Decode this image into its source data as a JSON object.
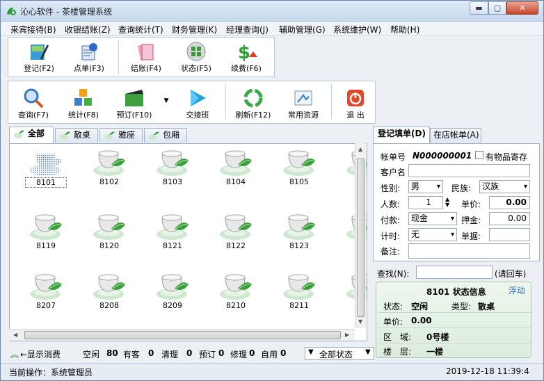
{
  "window": {
    "title": "沁心软件 - 茶楼管理系统",
    "min_label": "▬",
    "max_label": "▢",
    "close_label": "✕"
  },
  "menu": [
    "来宾接待(B)",
    "收银结账(Z)",
    "查询统计(T)",
    "财务管理(K)",
    "经理查询(J)",
    "辅助管理(G)",
    "系统维护(W)",
    "帮助(H)"
  ],
  "toolbar1": {
    "register": "登记(F2)",
    "order": "点单(F3)",
    "checkout": "结账(F4)",
    "status": "状态(F5)",
    "renew": "续费(F6)"
  },
  "toolbar2": {
    "query": "查询(F7)",
    "stats": "统计(F8)",
    "reserve": "预订(F10)",
    "shift": "交接班",
    "refresh": "刷新(F12)",
    "resources": "常用资源",
    "exit": "退 出"
  },
  "room_tabs": [
    "全部",
    "散桌",
    "雅座",
    "包厢"
  ],
  "rooms": [
    "8101",
    "8102",
    "8103",
    "8104",
    "8105",
    "8",
    "8119",
    "8120",
    "8121",
    "8122",
    "8123",
    "8",
    "8207",
    "8208",
    "8209",
    "8210",
    "8211",
    "8"
  ],
  "status_line": {
    "toggle": "←显示消费",
    "free_label": "空闲",
    "free_count": "80",
    "occupied_label": "有客",
    "occupied_count": "0",
    "cleaning_label": "清理",
    "cleaning_count": "0",
    "reserved_label": "预订",
    "reserved_count": "0",
    "repair_label": "修理",
    "repair_count": "0",
    "self_label": "自用",
    "self_count": "0",
    "state_select": "全部状态"
  },
  "bottom": {
    "operation": "当前操作：系统管理员",
    "datetime": "2019-12-18 11:39:4"
  },
  "right_tabs": [
    "登记填单(D)",
    "在店帐单(A)"
  ],
  "form": {
    "bill_no_label": "帐单号",
    "bill_no": "N000000001",
    "deposit_items_label": "有物品寄存",
    "customer_label": "客户名",
    "customer": "",
    "gender_label": "性别:",
    "gender": "男",
    "ethnic_label": "民族:",
    "ethnic": "汉族",
    "people_label": "人数:",
    "people": "1",
    "price_label": "单价:",
    "price": "0.00",
    "pay_label": "付款:",
    "pay": "现金",
    "deposit_label": "押金:",
    "deposit": "0.00",
    "timing_label": "计时:",
    "timing": "无",
    "receipt_label": "单据:",
    "receipt": "",
    "note_label": "备注:",
    "note": ""
  },
  "search": {
    "label": "查找(N):",
    "value": "",
    "hint": "(请回车)"
  },
  "info": {
    "title": "8101 状态信息",
    "float": "浮动",
    "state_label": "状态:",
    "state": "空闲",
    "type_label": "类型:",
    "type": "散桌",
    "price_label": "单价:",
    "price": "0.00",
    "area_label": "区　域:",
    "area": "0号楼",
    "floor_label": "楼　层:",
    "floor": "一楼"
  }
}
